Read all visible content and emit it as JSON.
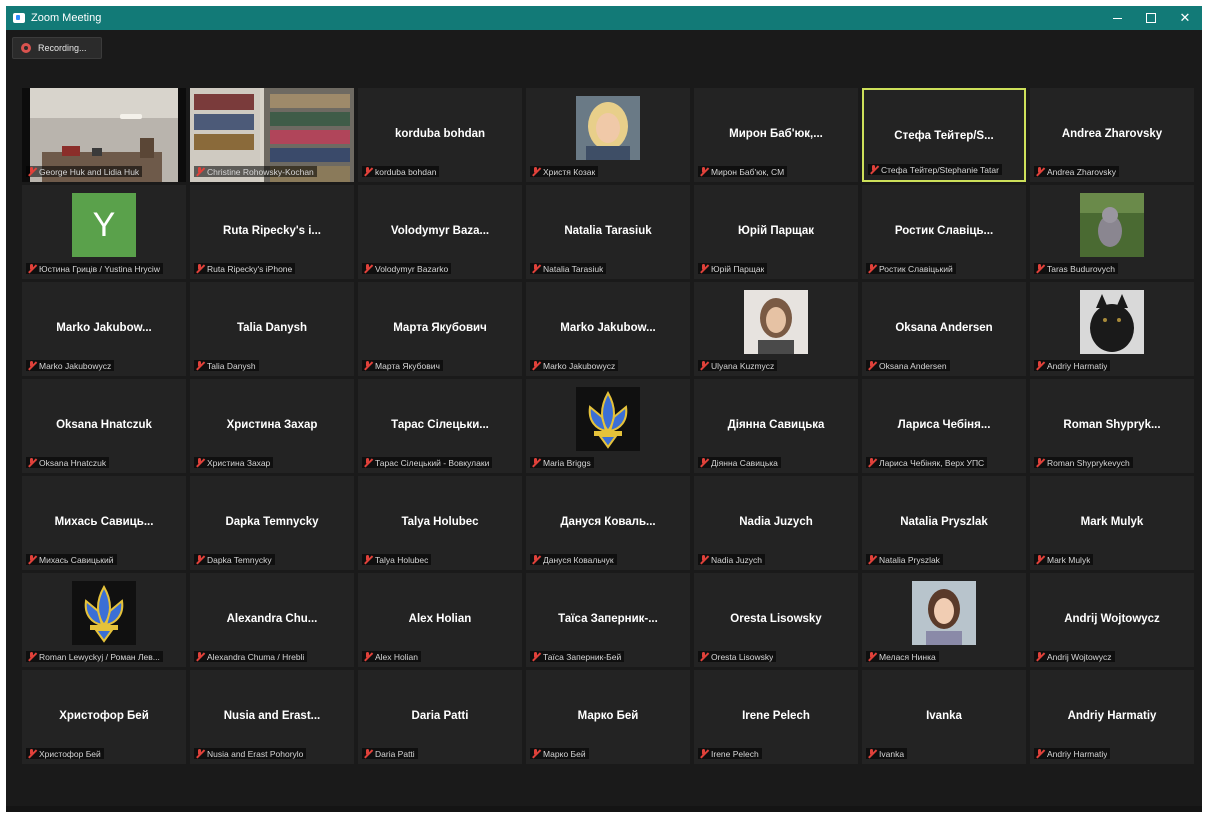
{
  "window": {
    "title": "Zoom Meeting"
  },
  "recording": {
    "label": "Recording..."
  },
  "tiles": [
    {
      "name": "",
      "label": "George Huk and Lidia Huk",
      "kind": "video-room"
    },
    {
      "name": "",
      "label": "Christine Rohowsky-Kochan",
      "kind": "video-shelf"
    },
    {
      "name": "korduba bohdan",
      "label": "korduba bohdan",
      "kind": "text"
    },
    {
      "name": "",
      "label": "Христя Козак",
      "kind": "photo-blonde"
    },
    {
      "name": "Мирон Баб'юк,...",
      "label": "Мирон Баб'юк, CM",
      "kind": "text"
    },
    {
      "name": "Стефа Тейтер/S...",
      "label": "Стефа Тейтер/Stephanie Tatar",
      "kind": "text",
      "active": true
    },
    {
      "name": "Andrea Zharovsky",
      "label": "Andrea Zharovsky",
      "kind": "text"
    },
    {
      "name": "",
      "label": "Юстина Гриців / Yustina Hryciw",
      "kind": "letter",
      "letter": "Y"
    },
    {
      "name": "Ruta Ripecky's i...",
      "label": "Ruta Ripecky's iPhone",
      "kind": "text"
    },
    {
      "name": "Volodymyr Baza...",
      "label": "Volodymyr Bazarko",
      "kind": "text"
    },
    {
      "name": "Natalia Tarasiuk",
      "label": "Natalia Tarasiuk",
      "kind": "text"
    },
    {
      "name": "Юрій Парщак",
      "label": "Юрій Парщак",
      "kind": "text"
    },
    {
      "name": "Ростик Славіць...",
      "label": "Ростик Славіцький",
      "kind": "text"
    },
    {
      "name": "",
      "label": "Taras Budurovych",
      "kind": "photo-cat"
    },
    {
      "name": "Marko Jakubow...",
      "label": "Marko Jakubowycz",
      "kind": "text"
    },
    {
      "name": "Talia Danysh",
      "label": "Talia Danysh",
      "kind": "text"
    },
    {
      "name": "Марта Якубович",
      "label": "Марта Якубович",
      "kind": "text"
    },
    {
      "name": "Marko Jakubow...",
      "label": "Marko Jakubowycz",
      "kind": "text"
    },
    {
      "name": "",
      "label": "Ulyana Kuzmycz",
      "kind": "photo-woman"
    },
    {
      "name": "Oksana Andersen",
      "label": "Oksana Andersen",
      "kind": "text"
    },
    {
      "name": "",
      "label": "Andriy Harmatiy",
      "kind": "photo-wolf"
    },
    {
      "name": "Oksana Hnatczuk",
      "label": "Oksana Hnatczuk",
      "kind": "text"
    },
    {
      "name": "Христина Захар",
      "label": "Христина Захар",
      "kind": "text"
    },
    {
      "name": "Тарас Сілецьки...",
      "label": "Тарас Сілецький - Вовкулаки",
      "kind": "text"
    },
    {
      "name": "",
      "label": "Maria Briggs",
      "kind": "emblem"
    },
    {
      "name": "Діянна Савицька",
      "label": "Діянна Савицька",
      "kind": "text"
    },
    {
      "name": "Лариса Чебіня...",
      "label": "Лариса Чебіняк, Верх УПС",
      "kind": "text"
    },
    {
      "name": "Roman Shypryk...",
      "label": "Roman Shyprykevych",
      "kind": "text"
    },
    {
      "name": "Михась Савиць...",
      "label": "Михась Савицький",
      "kind": "text"
    },
    {
      "name": "Dapka Temnycky",
      "label": "Dapka Temnycky",
      "kind": "text"
    },
    {
      "name": "Talya Holubec",
      "label": "Talya Holubec",
      "kind": "text"
    },
    {
      "name": "Дануся Коваль...",
      "label": "Дануся Ковальчук",
      "kind": "text"
    },
    {
      "name": "Nadia Juzych",
      "label": "Nadia Juzych",
      "kind": "text"
    },
    {
      "name": "Natalia Pryszlak",
      "label": "Natalia Pryszlak",
      "kind": "text"
    },
    {
      "name": "Mark Mulyk",
      "label": "Mark Mulyk",
      "kind": "text"
    },
    {
      "name": "",
      "label": "Roman Lewyckyj / Роман Лев...",
      "kind": "emblem"
    },
    {
      "name": "Alexandra Chu...",
      "label": "Alexandra Chuma / Hrebli",
      "kind": "text"
    },
    {
      "name": "Alex Holian",
      "label": "Alex Holian",
      "kind": "text"
    },
    {
      "name": "Таїса Заперник-...",
      "label": "Таїса Заперник-Бей",
      "kind": "text"
    },
    {
      "name": "Oresta Lisowsky",
      "label": "Oresta Lisowsky",
      "kind": "text"
    },
    {
      "name": "",
      "label": "Мелася Нинка",
      "kind": "photo-woman2"
    },
    {
      "name": "Andrij Wojtowycz",
      "label": "Andrij Wojtowycz",
      "kind": "text"
    },
    {
      "name": "Христофор Бей",
      "label": "Христофор Бей",
      "kind": "text"
    },
    {
      "name": "Nusia and Erast...",
      "label": "Nusia and Erast Pohorylo",
      "kind": "text"
    },
    {
      "name": "Daria Patti",
      "label": "Daria Patti",
      "kind": "text"
    },
    {
      "name": "Марко Бей",
      "label": "Марко Бей",
      "kind": "text"
    },
    {
      "name": "Irene Pelech",
      "label": "Irene Pelech",
      "kind": "text"
    },
    {
      "name": "Ivanka",
      "label": "Ivanka",
      "kind": "text"
    },
    {
      "name": "Andriy Harmatiy",
      "label": "Andriy Harmatiy",
      "kind": "text"
    }
  ],
  "colors": {
    "titlebar": "#127a77",
    "active_speaker": "#cde05a",
    "muted": "#e0413a"
  }
}
